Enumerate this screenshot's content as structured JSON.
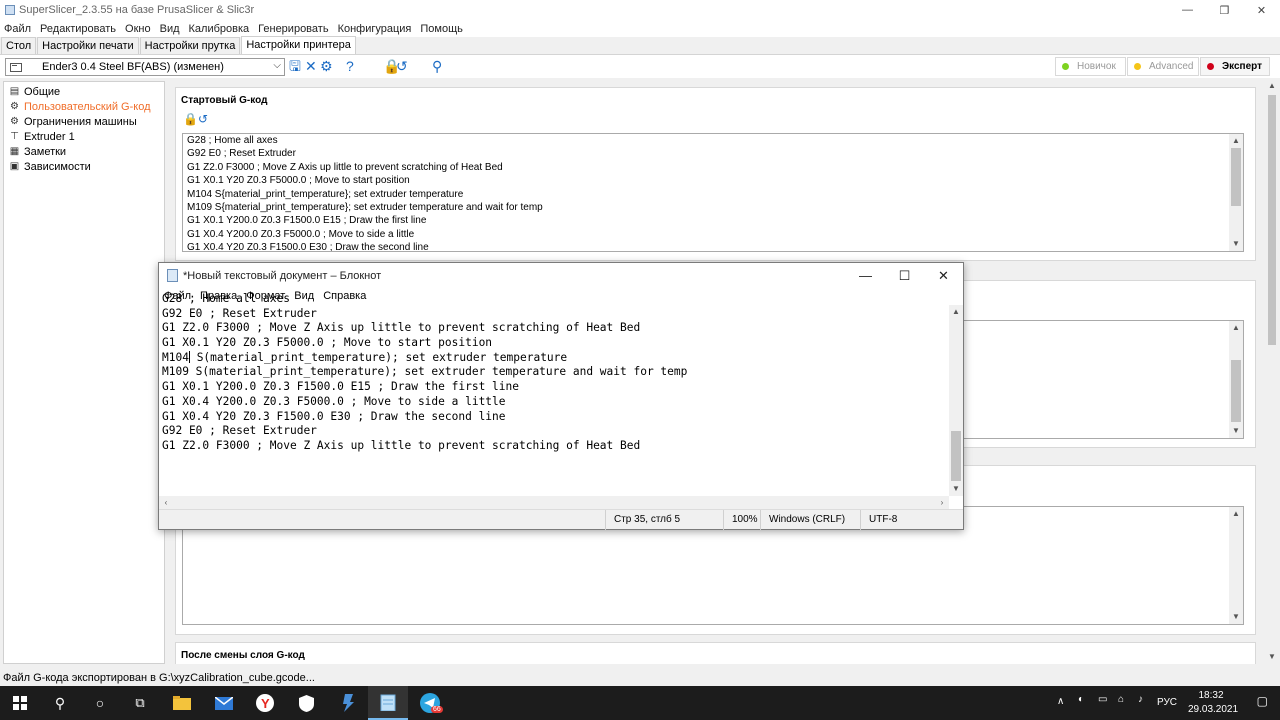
{
  "window": {
    "title": "SuperSlicer_2.3.55 на базе PrusaSlicer & Slic3r",
    "minimize_icon": "minimize-icon",
    "maximize_icon": "restore-icon",
    "close_icon": "close-icon"
  },
  "menu": [
    "Файл",
    "Редактировать",
    "Окно",
    "Вид",
    "Калибровка",
    "Генерировать",
    "Конфигурация",
    "Помощь"
  ],
  "tabs": [
    "Стол",
    "Настройки печати",
    "Настройки прутка",
    "Настройки принтера"
  ],
  "active_tab": "Настройки принтера",
  "toolbar": {
    "preset": "Ender3 0.4 Steel BF(ABS) (изменен)",
    "icons": [
      "save-icon",
      "delete-icon",
      "settings-icon",
      "help-icon",
      "lock-icon",
      "undo-icon",
      "search-icon"
    ],
    "modes": [
      {
        "label": "Новичок",
        "color": "#7ed321"
      },
      {
        "label": "Advanced",
        "color": "#f5c518"
      },
      {
        "label": "Эксперт",
        "color": "#d0021b"
      }
    ]
  },
  "tree": [
    {
      "label": "Общие",
      "icon": "printer-icon"
    },
    {
      "label": "Пользовательский G-код",
      "icon": "gear-icon",
      "selected": true
    },
    {
      "label": "Ограничения машины",
      "icon": "gear-icon"
    },
    {
      "label": "Extruder 1",
      "icon": "extruder-icon"
    },
    {
      "label": "Заметки",
      "icon": "notes-icon"
    },
    {
      "label": "Зависимости",
      "icon": "dependencies-icon"
    }
  ],
  "sections": {
    "start_gcode": {
      "title": "Стартовый G-код",
      "lines": [
        "G28 ; Home all axes",
        "G92 E0 ; Reset Extruder",
        "G1 Z2.0 F3000 ; Move Z Axis up little to prevent scratching of Heat Bed",
        "G1 X0.1 Y20 Z0.3 F5000.0 ; Move to start position",
        "M104 S{material_print_temperature}; set extruder temperature",
        "M109 S{material_print_temperature}; set extruder temperature and wait for temp",
        "G1 X0.1 Y200.0 Z0.3 F1500.0 E15 ; Draw the first line",
        "G1 X0.4 Y200.0 Z0.3 F5000.0 ; Move to side a little",
        "G1 X0.4 Y20 Z0.3 F1500.0 E30 ; Draw the second line"
      ]
    },
    "after_layer": {
      "title": "После смены слоя G-код"
    }
  },
  "status": "Файл G-кода экспортирован в G:\\xyzCalibration_cube.gcode...",
  "notepad": {
    "title": "*Новый текстовый документ – Блокнот",
    "menu": [
      "Файл",
      "Правка",
      "Формат",
      "Вид",
      "Справка"
    ],
    "lines": [
      "G28 ; Home all axes",
      "G92 E0 ; Reset Extruder",
      "G1 Z2.0 F3000 ; Move Z Axis up little to prevent scratching of Heat Bed",
      "G1 X0.1 Y20 Z0.3 F5000.0 ; Move to start position",
      "M104 S(material_print_temperature); set extruder temperature",
      "M109 S(material_print_temperature); set extruder temperature and wait for temp",
      "G1 X0.1 Y200.0 Z0.3 F1500.0 E15 ; Draw the first line",
      "G1 X0.4 Y200.0 Z0.3 F5000.0 ; Move to side a little",
      "G1 X0.4 Y20 Z0.3 F1500.0 E30 ; Draw the second line",
      "G92 E0 ; Reset Extruder",
      "G1 Z2.0 F3000 ; Move Z Axis up little to prevent scratching of Heat Bed"
    ],
    "status": {
      "position": "Стр 35, стлб 5",
      "zoom": "100%",
      "line_endings": "Windows (CRLF)",
      "encoding": "UTF-8"
    }
  },
  "taskbar": {
    "apps": [
      "windows-start-icon",
      "search-icon",
      "cortana-icon",
      "task-view-icon",
      "file-explorer-icon",
      "mail-icon",
      "yandex-browser-icon",
      "security-icon",
      "superslicer-icon",
      "notepad-icon",
      "telegram-icon"
    ],
    "telegram_badge": "66",
    "language": "РУС",
    "time": "18:32",
    "date": "29.03.2021"
  }
}
